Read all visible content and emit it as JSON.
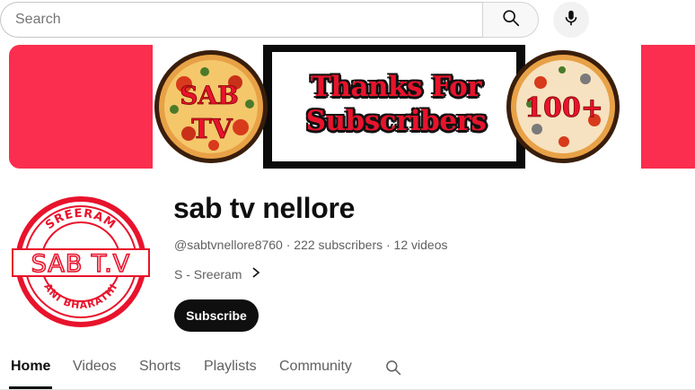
{
  "search": {
    "placeholder": "Search",
    "value": ""
  },
  "icons": {
    "search": "search-icon",
    "mic": "microphone-icon",
    "chevron": "chevron-right-icon",
    "tab_search": "search-icon"
  },
  "banner": {
    "line1": "Thanks For",
    "line2": "Subscribers",
    "left_logo_text": "SAB TV",
    "right_badge_text": "100+",
    "colors": {
      "background": "#fb2e4f",
      "text": "#e8132c",
      "outline": "#111111"
    }
  },
  "avatar": {
    "top_text": "SREERAM",
    "middle_text": "SAB T.V",
    "bottom_text": "ANI BHARATHI",
    "color": "#e8132c"
  },
  "channel": {
    "name": "sab tv nellore",
    "meta": "@sabtvnellore8760 · 222 subscribers · 12 videos",
    "link_label": "S - Sreeram",
    "subscribe_label": "Subscribe"
  },
  "tabs": [
    {
      "label": "Home",
      "active": true
    },
    {
      "label": "Videos",
      "active": false
    },
    {
      "label": "Shorts",
      "active": false
    },
    {
      "label": "Playlists",
      "active": false
    },
    {
      "label": "Community",
      "active": false
    }
  ]
}
